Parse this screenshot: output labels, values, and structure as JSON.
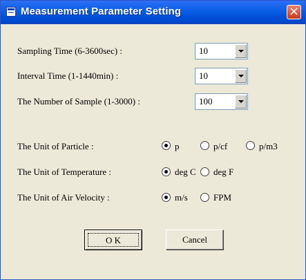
{
  "window": {
    "title": "Measurement Parameter Setting",
    "close_label": "×"
  },
  "fields": [
    {
      "label": "Sampling Time (6-3600sec) :",
      "value": "10"
    },
    {
      "label": "Interval Time (1-1440min) :",
      "value": "10"
    },
    {
      "label": "The Number of Sample (1-3000) :",
      "value": "100"
    }
  ],
  "radio_groups": [
    {
      "label": "The Unit of Particle :",
      "options": [
        "p",
        "p/cf",
        "p/m3"
      ],
      "selected": "p"
    },
    {
      "label": "The Unit of Temperature :",
      "options": [
        "deg C",
        "deg F"
      ],
      "selected": "deg C"
    },
    {
      "label": "The Unit of Air Velocity :",
      "options": [
        "m/s",
        "FPM"
      ],
      "selected": "m/s"
    }
  ],
  "buttons": {
    "ok_label": "O K",
    "cancel_label": "Cancel"
  }
}
